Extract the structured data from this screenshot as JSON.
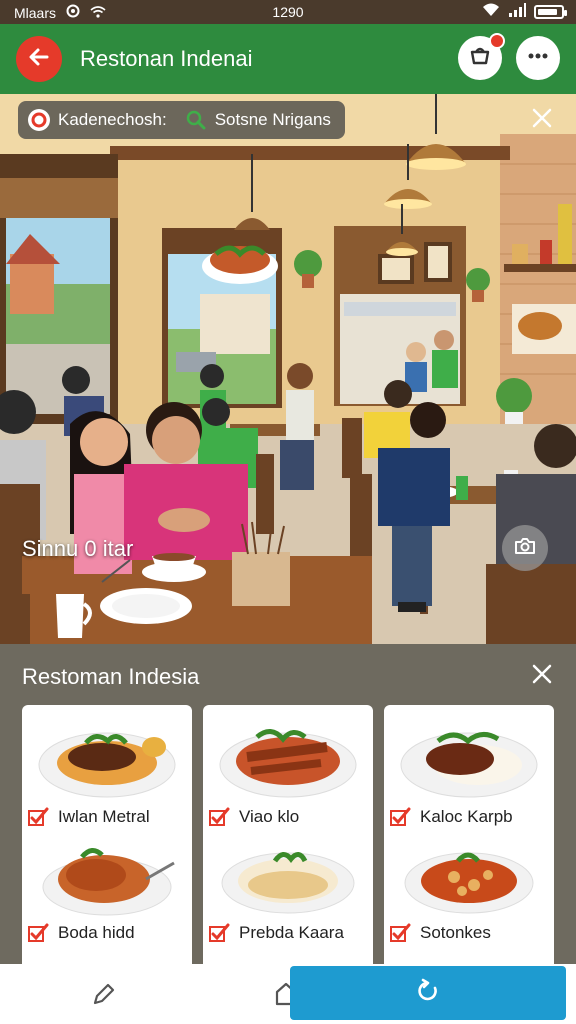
{
  "status_bar": {
    "carrier": "Mlaars",
    "time": "1290",
    "battery_level": 0.85
  },
  "app_bar": {
    "title": "Restonan Indenai",
    "back_icon": "arrow-left-icon",
    "cart_icon": "cart-icon",
    "more_icon": "more-dots-icon",
    "accent": "#2e8b3e",
    "back_color": "#e53a2a"
  },
  "filters": {
    "chips": [
      {
        "label": "Kadenechosh:",
        "icon": "location-pin-icon",
        "color": "#e53a2a"
      },
      {
        "label": "Sotsne Nrigans",
        "icon": "leaf-icon",
        "color": "#3fae49"
      }
    ]
  },
  "scene": {
    "caption": "Sinnu 0 itar"
  },
  "sheet": {
    "title": "Restoman Indesia",
    "dishes": [
      {
        "name": "Iwlan Metral"
      },
      {
        "name": "Viao klo"
      },
      {
        "name": "Kaloc Karpb"
      },
      {
        "name": "Boda hidd"
      },
      {
        "name": "Prebda Kaara"
      },
      {
        "name": "Sotonkes"
      }
    ]
  },
  "bottom_nav": {
    "items": [
      "edit-icon",
      "home-icon",
      "refresh-icon"
    ],
    "action_color": "#1e9bd0"
  }
}
